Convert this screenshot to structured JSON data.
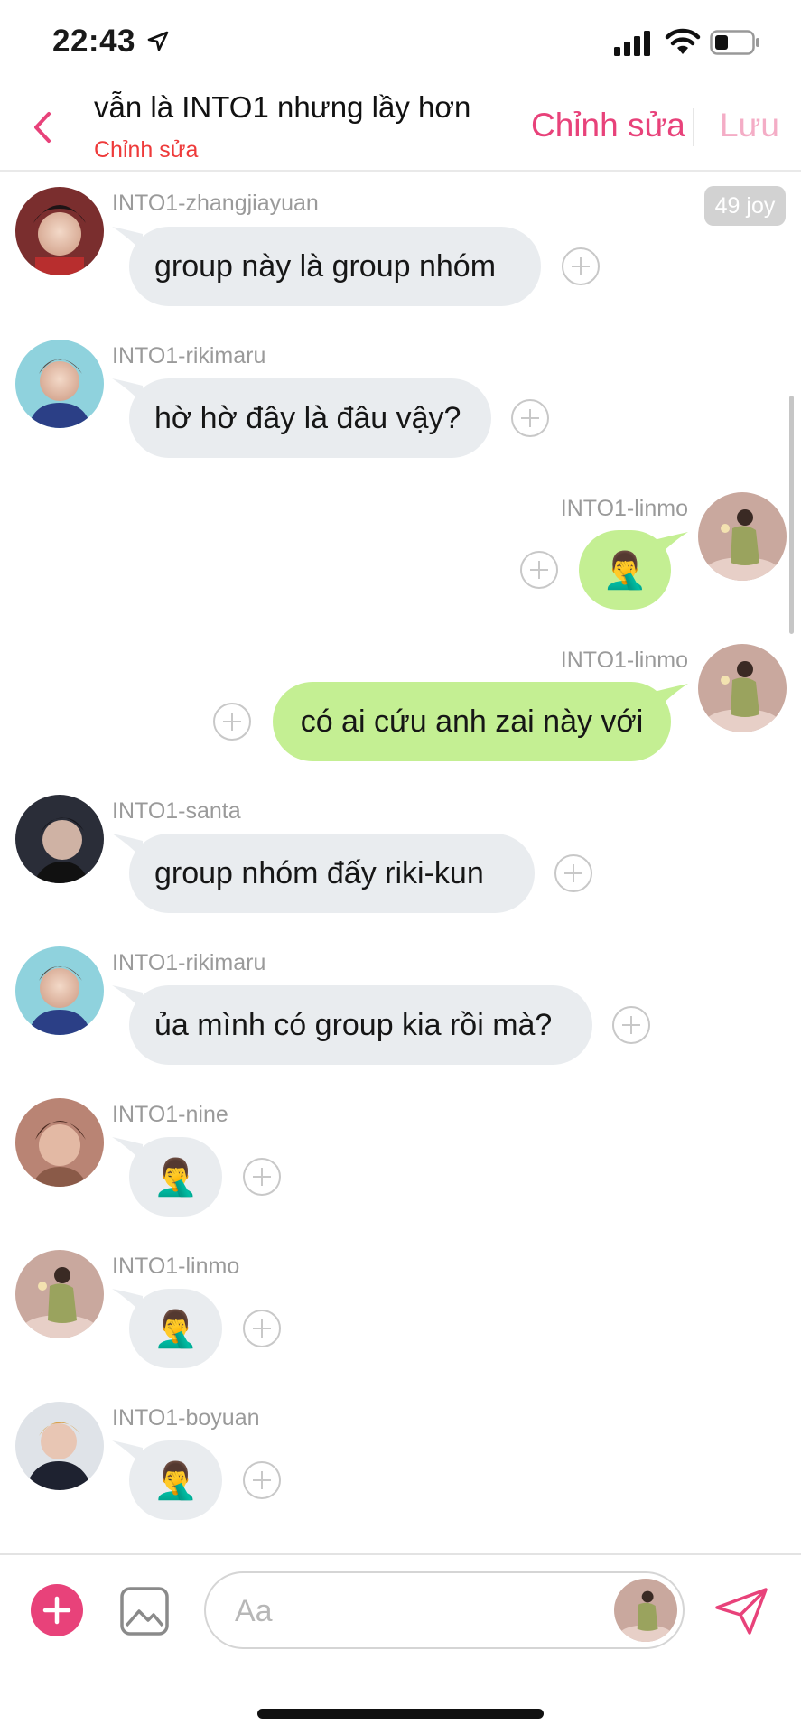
{
  "status": {
    "time": "22:43",
    "icons": [
      "location-arrow-icon",
      "signal-icon",
      "wifi-icon",
      "battery-icon"
    ]
  },
  "header": {
    "title": "vẫn là INTO1 nhưng lầy hơn",
    "subtitle": "Chỉnh sửa",
    "edit_label": "Chỉnh sửa",
    "save_label": "Lưu",
    "back_icon": "chevron-left-icon"
  },
  "badge": {
    "joy": "49 joy"
  },
  "messages": [
    {
      "sender": "INTO1-zhangjiayuan",
      "text": "group này là group nhóm",
      "side": "left"
    },
    {
      "sender": "INTO1-rikimaru",
      "text": "hờ hờ đây là đâu vậy?",
      "side": "left"
    },
    {
      "sender": "INTO1-linmo",
      "text": "🤦‍♂️",
      "side": "right"
    },
    {
      "sender": "INTO1-linmo",
      "text": "có ai cứu anh zai này với",
      "side": "right"
    },
    {
      "sender": "INTO1-santa",
      "text": "group nhóm đấy riki-kun",
      "side": "left"
    },
    {
      "sender": "INTO1-rikimaru",
      "text": "ủa mình có group kia rồi mà?",
      "side": "left"
    },
    {
      "sender": "INTO1-nine",
      "text": "🤦‍♂️",
      "side": "left"
    },
    {
      "sender": "INTO1-linmo",
      "text": "🤦‍♂️",
      "side": "left"
    },
    {
      "sender": "INTO1-boyuan",
      "text": "🤦‍♂️",
      "side": "left"
    }
  ],
  "composer": {
    "placeholder": "Aa",
    "add_icon": "plus-icon",
    "image_icon": "image-icon",
    "send_icon": "send-icon"
  },
  "colors": {
    "accent": "#e8427a",
    "subtitle": "#ee3a3a",
    "save_disabled": "#f4adc6",
    "bubble_gray": "#e9ecef",
    "bubble_green": "#c4ef93"
  }
}
